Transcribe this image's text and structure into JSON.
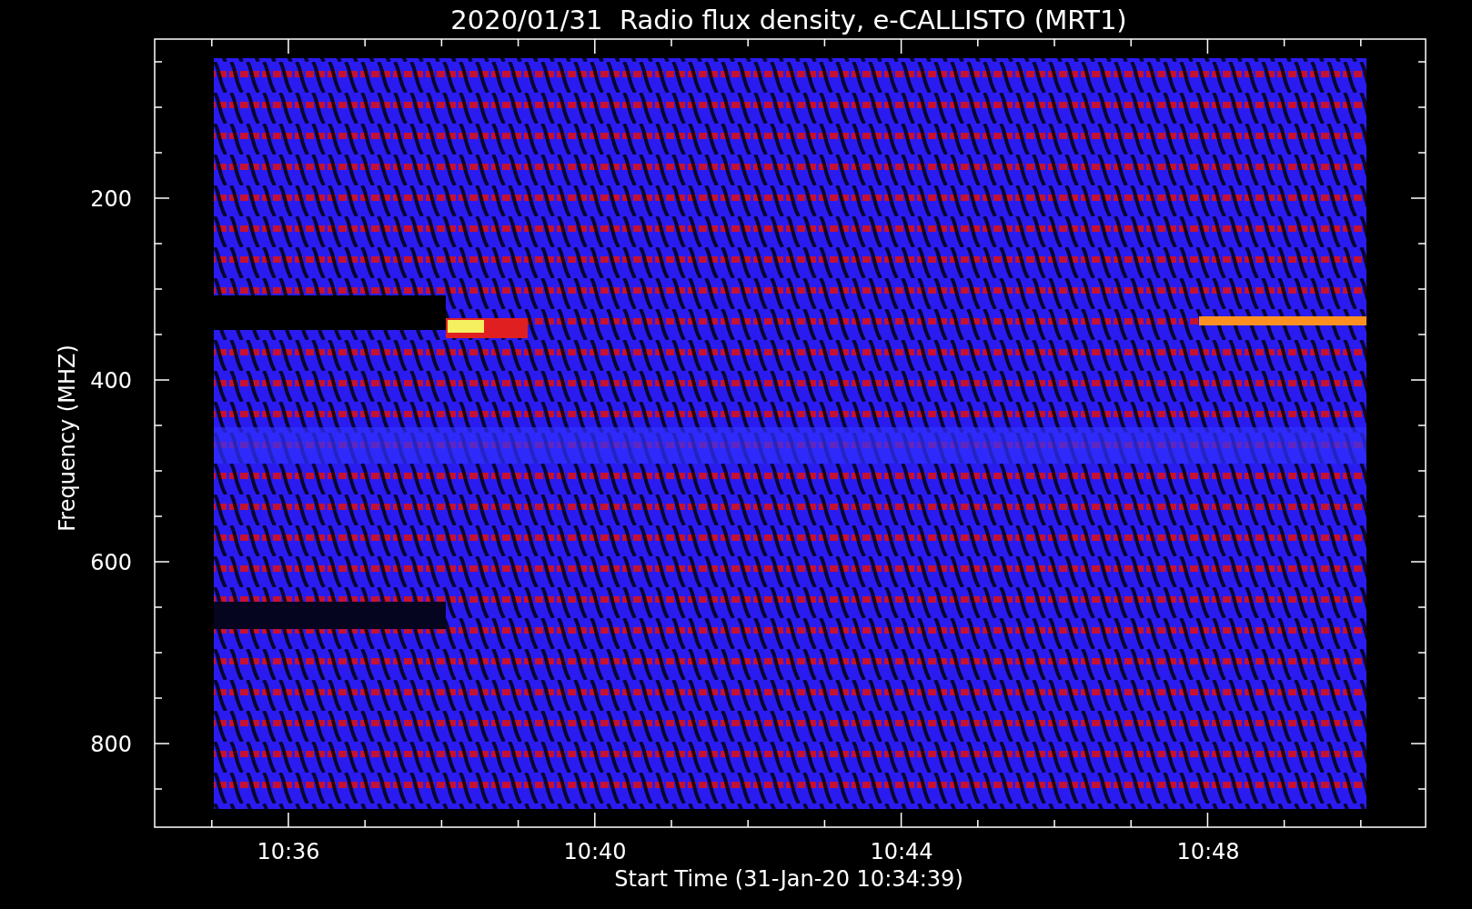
{
  "title": "2020/01/31  Radio flux density, e-CALLISTO (MRT1)",
  "y_axis": {
    "label": "Frequency (MHZ)",
    "ticks": [
      "200",
      "400",
      "600",
      "800"
    ]
  },
  "x_axis": {
    "label": "Start Time (31-Jan-20 10:34:39)",
    "ticks": [
      "10:36",
      "10:40",
      "10:44",
      "10:48"
    ]
  }
}
